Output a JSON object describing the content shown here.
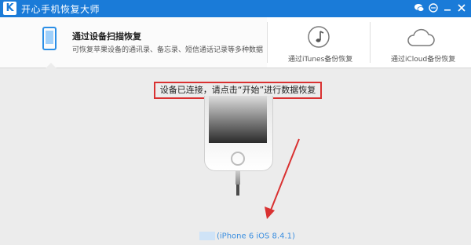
{
  "app": {
    "title": "开心手机恢复大师",
    "logo": "K"
  },
  "titlebar_icons": [
    "wechat-icon",
    "chat-icon",
    "minimize-icon",
    "close-icon"
  ],
  "tabs": [
    {
      "title": "通过设备扫描恢复",
      "desc": "可恢复苹果设备的通讯录、备忘录、短信通话记录等多种数据"
    },
    {
      "label": "通过iTunes备份恢复",
      "icon": "music-note-icon"
    },
    {
      "label": "通过iCloud备份恢复",
      "icon": "cloud-icon"
    }
  ],
  "notice": "设备已连接，请点击“开始”进行数据恢复",
  "device": {
    "name": "(iPhone 6 iOS 8.4.1)"
  },
  "colors": {
    "title_bar": "#1a7bd8",
    "notice_border": "#d93131",
    "arrow": "#d93131",
    "device_text": "#3a8ee0"
  }
}
